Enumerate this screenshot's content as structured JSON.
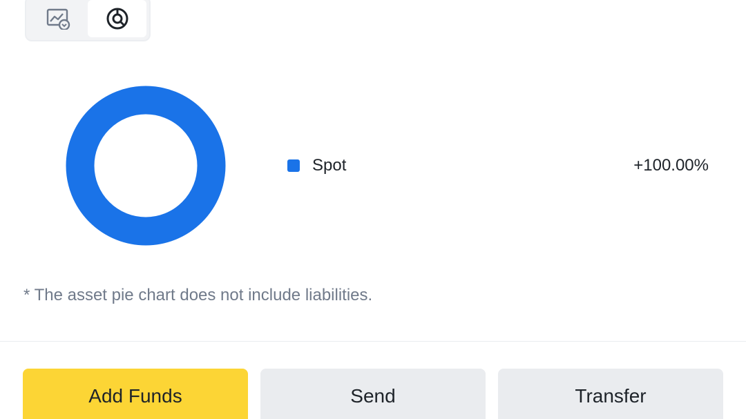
{
  "view_toggle": {
    "options": [
      {
        "icon": "trend-chart-icon",
        "active": false
      },
      {
        "icon": "pie-chart-icon",
        "active": true
      }
    ]
  },
  "chart_data": {
    "type": "pie",
    "style": "donut",
    "slices": [
      {
        "label": "Spot",
        "value": 100.0,
        "display": "+100.00%",
        "color": "#1a73e8"
      }
    ]
  },
  "legend": {
    "items": [
      {
        "label": "Spot",
        "value": "+100.00%",
        "color": "#1a73e8"
      }
    ]
  },
  "footnote": "* The asset pie chart does not include liabilities.",
  "actions": {
    "add_funds": "Add Funds",
    "send": "Send",
    "transfer": "Transfer"
  },
  "colors": {
    "accent": "#fcd535",
    "chart_primary": "#1a73e8",
    "text_secondary": "#707a8a"
  }
}
